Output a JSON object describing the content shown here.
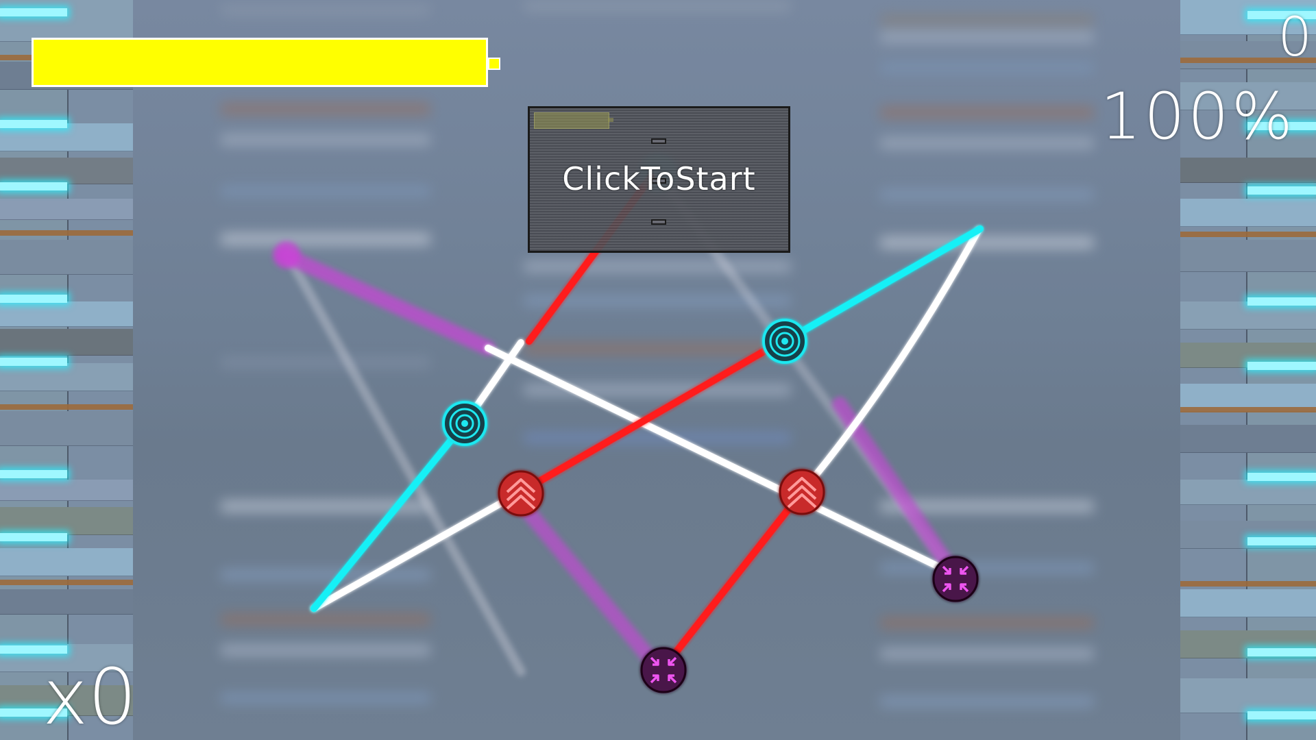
{
  "hud": {
    "score": "0",
    "accuracy": "100%",
    "combo": "x0",
    "health_fraction": 1.0
  },
  "start_prompt": {
    "label": "ClickToStart"
  },
  "colors": {
    "health": "#ffff00",
    "tap_note": "#1ee8f0",
    "flick_note": "#e23a3a",
    "hold_note": "#c030c8",
    "connector_white": "#ffffff",
    "connector_red": "#ff1a1a",
    "connector_cyan": "#12f0f6",
    "connector_magenta": "#d040e0",
    "side_glow": "#9ff7ff"
  },
  "notes": [
    {
      "kind": "tap",
      "icon": "target-icon"
    },
    {
      "kind": "tap",
      "icon": "target-icon"
    },
    {
      "kind": "flick",
      "icon": "double-chevron-up-icon"
    },
    {
      "kind": "flick",
      "icon": "double-chevron-up-icon"
    },
    {
      "kind": "hold",
      "icon": "compress-arrows-icon"
    },
    {
      "kind": "hold",
      "icon": "compress-arrows-icon"
    }
  ]
}
